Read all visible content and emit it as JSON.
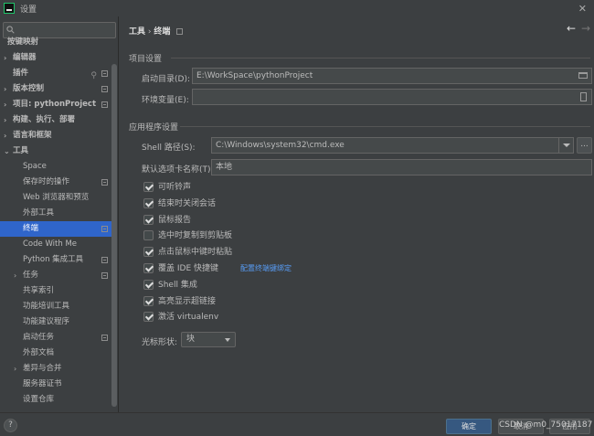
{
  "window": {
    "title": "设置"
  },
  "search": {
    "value": "",
    "placeholder": ""
  },
  "sidebar": {
    "items": [
      {
        "label": "按键映射",
        "arrow": "",
        "indent": 8,
        "bold": true,
        "selected": false,
        "cfg": false,
        "plug": false
      },
      {
        "label": "编辑器",
        "arrow": "›",
        "indent": 14,
        "bold": true,
        "selected": false,
        "cfg": false,
        "plug": false
      },
      {
        "label": "插件",
        "arrow": "",
        "indent": 14,
        "bold": true,
        "selected": false,
        "cfg": true,
        "plug": true
      },
      {
        "label": "版本控制",
        "arrow": "›",
        "indent": 14,
        "bold": true,
        "selected": false,
        "cfg": true,
        "plug": false
      },
      {
        "label": "项目: pythonProject",
        "arrow": "›",
        "indent": 14,
        "bold": true,
        "selected": false,
        "cfg": true,
        "plug": false
      },
      {
        "label": "构建、执行、部署",
        "arrow": "›",
        "indent": 14,
        "bold": true,
        "selected": false,
        "cfg": false,
        "plug": false
      },
      {
        "label": "语言和框架",
        "arrow": "›",
        "indent": 14,
        "bold": true,
        "selected": false,
        "cfg": false,
        "plug": false
      },
      {
        "label": "工具",
        "arrow": "⌄",
        "indent": 14,
        "bold": true,
        "selected": false,
        "cfg": false,
        "plug": false
      },
      {
        "label": "Space",
        "arrow": "",
        "indent": 25,
        "bold": false,
        "selected": false,
        "cfg": false,
        "plug": false
      },
      {
        "label": "保存时的操作",
        "arrow": "",
        "indent": 25,
        "bold": false,
        "selected": false,
        "cfg": true,
        "plug": false
      },
      {
        "label": "Web 浏览器和预览",
        "arrow": "",
        "indent": 25,
        "bold": false,
        "selected": false,
        "cfg": false,
        "plug": false
      },
      {
        "label": "外部工具",
        "arrow": "",
        "indent": 25,
        "bold": false,
        "selected": false,
        "cfg": false,
        "plug": false
      },
      {
        "label": "终端",
        "arrow": "",
        "indent": 25,
        "bold": false,
        "selected": true,
        "cfg": true,
        "plug": false
      },
      {
        "label": "Code With Me",
        "arrow": "",
        "indent": 25,
        "bold": false,
        "selected": false,
        "cfg": false,
        "plug": false
      },
      {
        "label": "Python 集成工具",
        "arrow": "",
        "indent": 25,
        "bold": false,
        "selected": false,
        "cfg": true,
        "plug": false
      },
      {
        "label": "任务",
        "arrow": "›",
        "indent": 25,
        "bold": false,
        "selected": false,
        "cfg": true,
        "plug": false
      },
      {
        "label": "共享索引",
        "arrow": "",
        "indent": 25,
        "bold": false,
        "selected": false,
        "cfg": false,
        "plug": false
      },
      {
        "label": "功能培训工具",
        "arrow": "",
        "indent": 25,
        "bold": false,
        "selected": false,
        "cfg": false,
        "plug": false
      },
      {
        "label": "功能建议程序",
        "arrow": "",
        "indent": 25,
        "bold": false,
        "selected": false,
        "cfg": false,
        "plug": false
      },
      {
        "label": "启动任务",
        "arrow": "",
        "indent": 25,
        "bold": false,
        "selected": false,
        "cfg": true,
        "plug": false
      },
      {
        "label": "外部文档",
        "arrow": "",
        "indent": 25,
        "bold": false,
        "selected": false,
        "cfg": false,
        "plug": false
      },
      {
        "label": "差异与合并",
        "arrow": "›",
        "indent": 25,
        "bold": false,
        "selected": false,
        "cfg": false,
        "plug": false
      },
      {
        "label": "服务器证书",
        "arrow": "",
        "indent": 25,
        "bold": false,
        "selected": false,
        "cfg": false,
        "plug": false
      },
      {
        "label": "设置仓库",
        "arrow": "",
        "indent": 25,
        "bold": false,
        "selected": false,
        "cfg": false,
        "plug": false
      }
    ]
  },
  "breadcrumb": {
    "parent": "工具",
    "separator": "›",
    "current": "终端"
  },
  "project_section": {
    "title": "项目设置",
    "start_dir_label": "启动目录(D):",
    "start_dir_value": "E:\\WorkSpace\\pythonProject",
    "env_label": "环境变量(E):",
    "env_value": ""
  },
  "app_section": {
    "title": "应用程序设置",
    "shell_label": "Shell 路径(S):",
    "shell_value": "C:\\Windows\\system32\\cmd.exe",
    "ellipsis": "...",
    "tab_label": "默认选项卡名称(T):",
    "tab_value": "本地"
  },
  "checkboxes": [
    {
      "label": "可听铃声",
      "checked": true,
      "link": ""
    },
    {
      "label": "结束时关闭会话",
      "checked": true,
      "link": ""
    },
    {
      "label": "鼠标报告",
      "checked": true,
      "link": ""
    },
    {
      "label": "选中时复制到剪贴板",
      "checked": false,
      "link": ""
    },
    {
      "label": "点击鼠标中键时粘贴",
      "checked": true,
      "link": ""
    },
    {
      "label": "覆盖 IDE 快捷键",
      "checked": true,
      "link": "配置终端键绑定"
    },
    {
      "label": "Shell 集成",
      "checked": true,
      "link": ""
    },
    {
      "label": "高亮显示超链接",
      "checked": true,
      "link": ""
    },
    {
      "label": "激活 virtualenv",
      "checked": true,
      "link": ""
    }
  ],
  "cursor": {
    "label": "光标形状:",
    "value": "块"
  },
  "footer": {
    "help": "?",
    "ok": "确定",
    "cancel": "取消",
    "apply": "应用",
    "watermark": "CSDN @m0_75017187"
  },
  "colors": {
    "accent": "#2f65ca",
    "ok_button": "#365880",
    "link": "#589df6"
  }
}
